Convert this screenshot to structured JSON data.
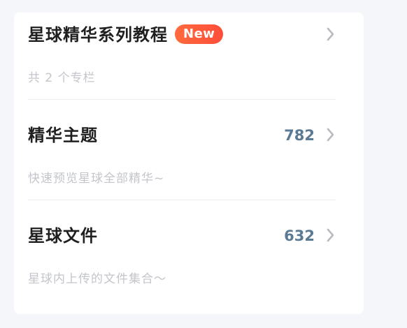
{
  "items": [
    {
      "title": "星球精华系列教程",
      "badge": "New",
      "subtitle": "共 2 个专栏",
      "count": ""
    },
    {
      "title": "精华主题",
      "badge": "",
      "subtitle": "快速预览星球全部精华~",
      "count": "782"
    },
    {
      "title": "星球文件",
      "badge": "",
      "subtitle": "星球内上传的文件集合～",
      "count": "632"
    }
  ],
  "icons": {
    "chevron": "chevron-right-icon"
  },
  "colors": {
    "badge": "#ff5a3b",
    "count": "#5b7a94",
    "subtitle": "#c3c5cb",
    "title": "#1f1f1f"
  }
}
